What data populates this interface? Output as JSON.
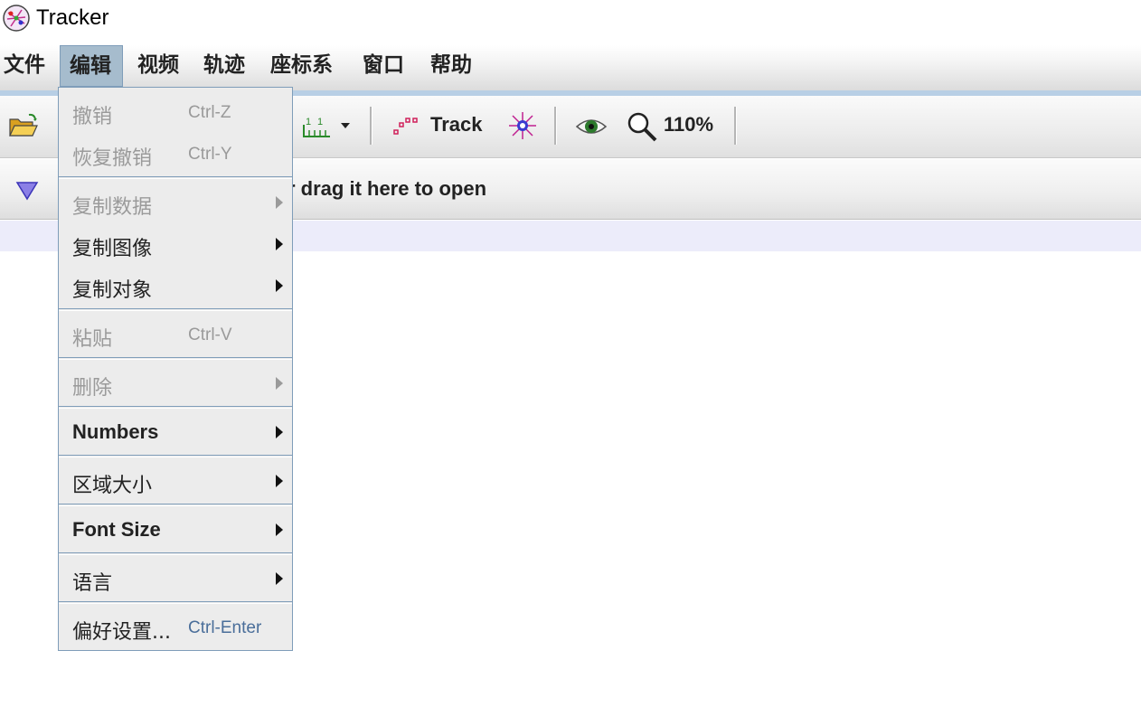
{
  "window": {
    "title": "Tracker"
  },
  "menubar": {
    "items": [
      {
        "label": "文件"
      },
      {
        "label": "编辑"
      },
      {
        "label": "视频"
      },
      {
        "label": "轨迹"
      },
      {
        "label": "座标系"
      },
      {
        "label": "窗口"
      },
      {
        "label": "帮助"
      }
    ]
  },
  "toolbar": {
    "track_label": "Track",
    "zoom_label": "110%"
  },
  "notes": {
    "text": "r drag it here to open"
  },
  "edit_menu": {
    "items": [
      {
        "label": "撤销",
        "shortcut": "Ctrl-Z",
        "enabled": false
      },
      {
        "label": "恢复撤销",
        "shortcut": "Ctrl-Y",
        "enabled": false
      },
      {
        "label": "复制数据",
        "enabled": false,
        "submenu": true
      },
      {
        "label": "复制图像",
        "enabled": true,
        "submenu": true
      },
      {
        "label": "复制对象",
        "enabled": true,
        "submenu": true
      },
      {
        "label": "粘贴",
        "shortcut": "Ctrl-V",
        "enabled": false
      },
      {
        "label": "删除",
        "enabled": false,
        "submenu": true
      },
      {
        "label": "Numbers",
        "enabled": true,
        "submenu": true
      },
      {
        "label": "区域大小",
        "enabled": true,
        "submenu": true
      },
      {
        "label": "Font Size",
        "enabled": true,
        "submenu": true
      },
      {
        "label": "语言",
        "enabled": true,
        "submenu": true
      },
      {
        "label": "偏好设置...",
        "shortcut": "Ctrl-Enter",
        "enabled": true
      }
    ]
  },
  "colors": {
    "menu_active_bg": "#a6bccd",
    "menu_border": "#7f9db9",
    "disabled_text": "#9a9a9a",
    "shortcut_enabled": "#4a6e9a"
  }
}
